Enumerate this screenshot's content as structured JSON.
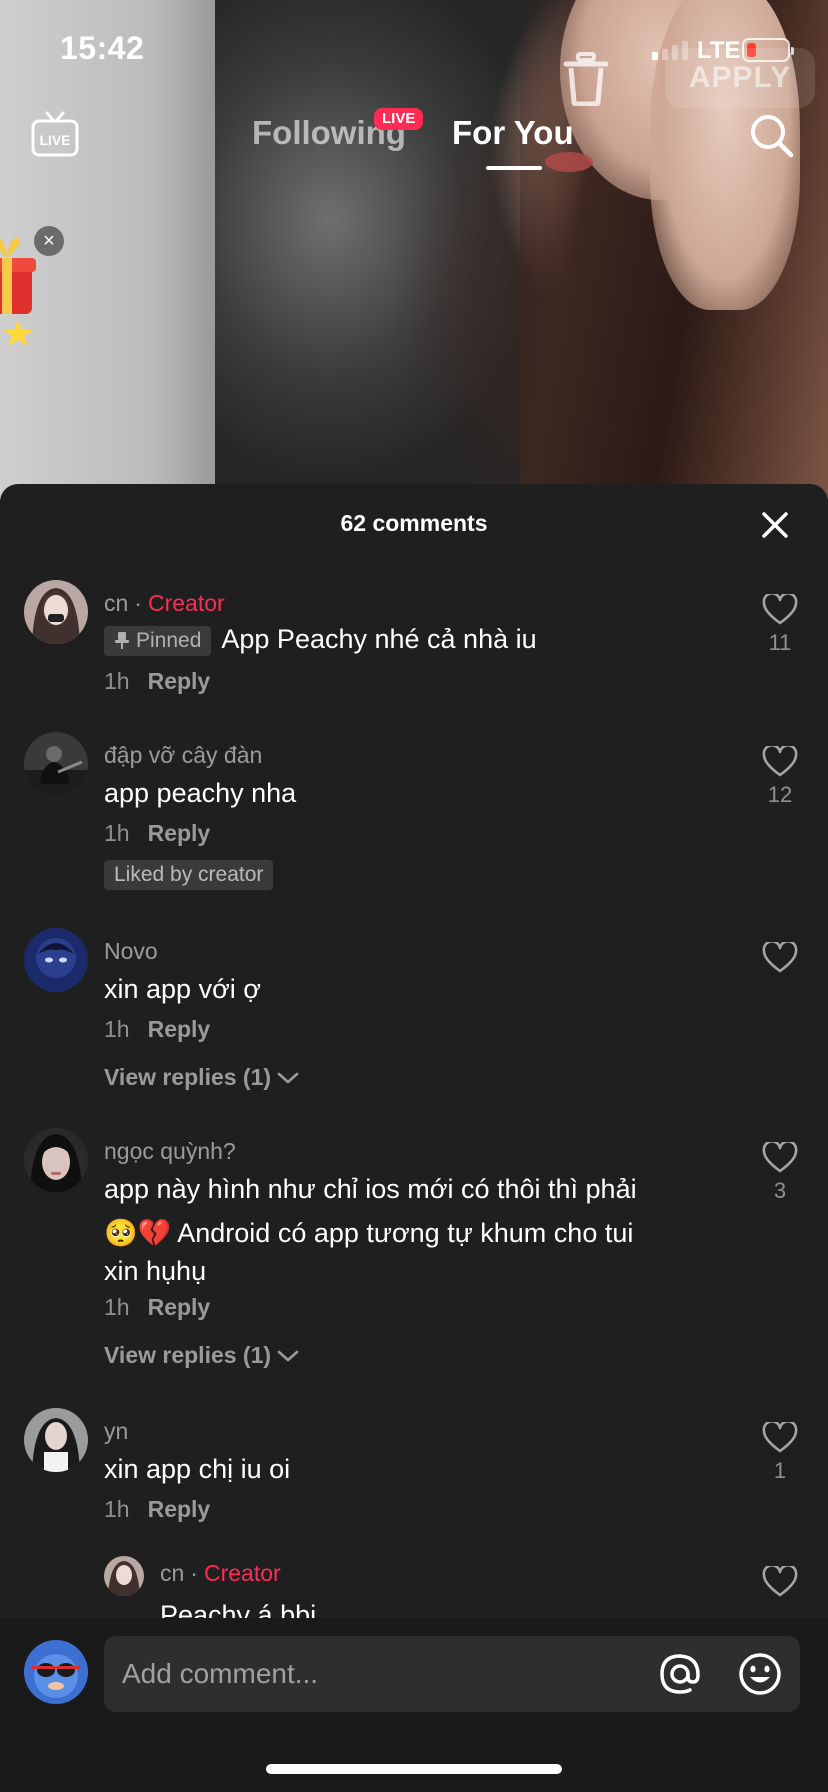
{
  "status_bar": {
    "time": "15:42",
    "network": "LTE"
  },
  "overlay": {
    "apply_label": "APPLY",
    "live_icon_label": "LIVE",
    "tabs": {
      "following": "Following",
      "following_badge": "LIVE",
      "for_you": "For You"
    }
  },
  "comments_sheet": {
    "title": "62 comments",
    "comments": [
      {
        "user": "cn",
        "creator_label": "Creator",
        "pinned_label": "Pinned",
        "text": "App Peachy nhé cả nhà iu",
        "time": "1h",
        "reply": "Reply",
        "likes": "11"
      },
      {
        "user": "đập vỡ cây đàn",
        "text": "app peachy nha",
        "time": "1h",
        "reply": "Reply",
        "likes": "12",
        "liked_by_creator": "Liked by creator"
      },
      {
        "user": "Novo",
        "text": "xin app với ợ",
        "time": "1h",
        "reply": "Reply",
        "likes": "",
        "view_replies": "View replies (1)"
      },
      {
        "user": "ngọc quỳnh?",
        "text_line1": "app này hình như chỉ ios mới có thôi thì phải",
        "text_line2": "🥺💔 Android có app tương tự khum cho tui",
        "text_line3": "xin hụhụ",
        "time": "1h",
        "reply": "Reply",
        "likes": "3",
        "view_replies": "View replies (1)"
      },
      {
        "user": "yn",
        "text": "xin app chị iu oi",
        "time": "1h",
        "reply": "Reply",
        "likes": "1"
      }
    ],
    "nested_reply": {
      "user": "cn",
      "creator_label": "Creator",
      "text": "Peachy á bbi"
    }
  },
  "input_bar": {
    "placeholder": "Add comment..."
  },
  "colors": {
    "accent": "#fe2c55",
    "sheet_bg": "#1f1f1f"
  }
}
